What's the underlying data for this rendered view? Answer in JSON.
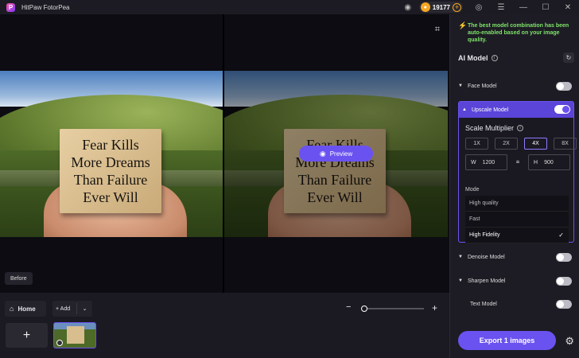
{
  "titlebar": {
    "app_name": "HitPaw FotorPea",
    "credits": "19177",
    "plus": "+"
  },
  "canvas": {
    "card_lines": [
      "Fear Kills",
      "More Dreams",
      "Than Failure",
      "Ever Will"
    ],
    "preview_label": "Preview",
    "before_label": "Before"
  },
  "bottom": {
    "home_label": "Home",
    "add_label": "Add",
    "zoom_level_fraction": 0.02
  },
  "panel": {
    "notice": "The best model combination has been auto-enabled based on your image quality.",
    "ai_model_title": "AI Model",
    "face_model": "Face Model",
    "upscale_model": "Upscale Model",
    "scale_multiplier": "Scale Multiplier",
    "multipliers": [
      "1X",
      "2X",
      "4X",
      "8X"
    ],
    "selected_multiplier": "4X",
    "width_label": "W",
    "width_value": "1200",
    "height_label": "H",
    "height_value": "900",
    "mode_label": "Mode",
    "modes": [
      "High quality",
      "Fast",
      "High Fidelity"
    ],
    "selected_mode": "High Fidelity",
    "denoise_model": "Denoise Model",
    "sharpen_model": "Sharpen Model",
    "text_model": "Text Model",
    "export_label": "Export 1 images"
  },
  "colors": {
    "accent": "#6a52f0",
    "notice_green": "#7fe36a",
    "background": "#16151d"
  }
}
